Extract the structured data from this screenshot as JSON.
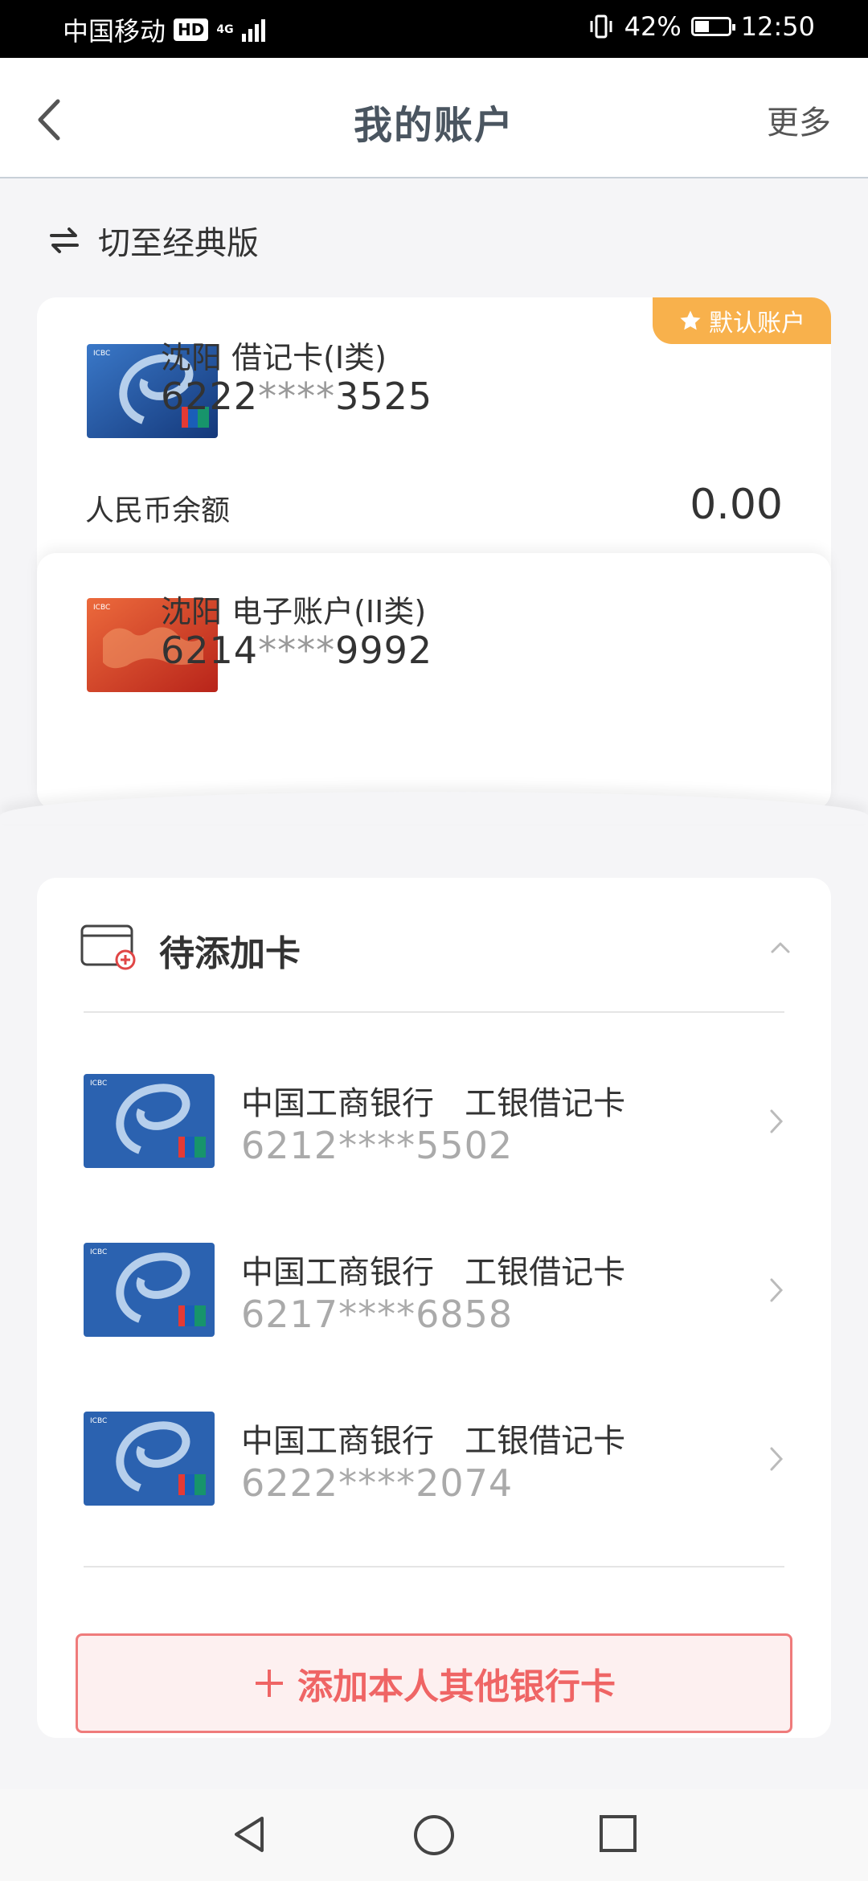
{
  "status_bar": {
    "carrier": "中国移动",
    "hd_badge": "HD",
    "network": "4G",
    "battery_percent": "42%",
    "battery_level": 0.42,
    "time": "12:50"
  },
  "nav": {
    "title": "我的账户",
    "more": "更多",
    "back_icon": "chevron-left-icon"
  },
  "switch_label": "切至经典版",
  "accounts": [
    {
      "default_tag": "默认账户",
      "name": "沈阳 借记卡(I类)",
      "num_prefix": "6222",
      "num_mask": "****",
      "num_suffix": "3525",
      "balance_label": "人民币余额",
      "balance": "0.00"
    },
    {
      "name": "沈阳 电子账户(II类)",
      "num_prefix": "6214",
      "num_mask": "****",
      "num_suffix": "9992"
    }
  ],
  "pending": {
    "title": "待添加卡",
    "items": [
      {
        "name": "中国工商银行   工银借记卡",
        "number": "6212****5502"
      },
      {
        "name": "中国工商银行   工银借记卡",
        "number": "6217****6858"
      },
      {
        "name": "中国工商银行   工银借记卡",
        "number": "6222****2074"
      }
    ],
    "add_button": "添加本人其他银行卡"
  },
  "colors": {
    "accent_orange": "#f8b14c",
    "add_red": "#ef6565",
    "card_blue": "#1f4fa0",
    "card_red": "#d9482c"
  }
}
